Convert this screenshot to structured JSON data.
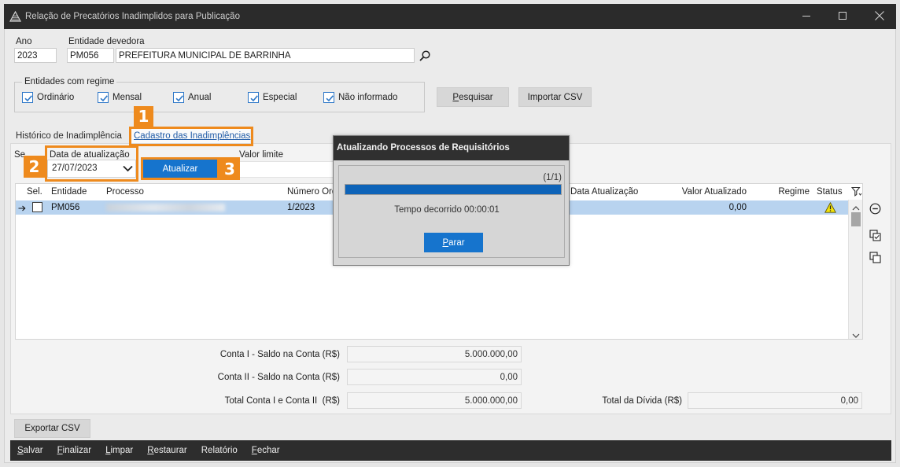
{
  "window": {
    "title": "Relação de Precatórios Inadimplidos para Publicação",
    "icons": {
      "app": "app-logo-icon",
      "minimize": "minimize-icon",
      "maximize": "maximize-icon",
      "close": "close-icon"
    }
  },
  "filters": {
    "ano_label": "Ano",
    "ano_value": "2023",
    "entidade_label": "Entidade devedora",
    "entidade_code": "PM056",
    "entidade_name": "PREFEITURA MUNICIPAL DE BARRINHA",
    "search_icon": "search-icon"
  },
  "regime": {
    "legend": "Entidades com regime",
    "options": [
      {
        "label": "Ordinário",
        "checked": true
      },
      {
        "label": "Mensal",
        "checked": true
      },
      {
        "label": "Anual",
        "checked": true
      },
      {
        "label": "Especial",
        "checked": true
      },
      {
        "label": "Não informado",
        "checked": true
      }
    ]
  },
  "actions": {
    "search_label": "Pesquisar",
    "import_label": "Importar CSV"
  },
  "tabs": [
    {
      "label": "Histórico de Inadimplência",
      "active": false
    },
    {
      "label": "Cadastro das Inadimplências",
      "active": true
    }
  ],
  "update_bar": {
    "sel_label": "Se",
    "date_label": "Data de atualização",
    "date_value": "27/07/2023",
    "update_label": "Atualizar",
    "limit_label": "Valor limite"
  },
  "table": {
    "columns": [
      "Sel.",
      "Entidade",
      "Processo",
      "Número Ord",
      "Data Atualização",
      "Valor Atualizado",
      "Regime",
      "Status"
    ],
    "filter_icon": "filter-icon",
    "rows": [
      {
        "selected": false,
        "entidade": "PM056",
        "numero": "1/2023",
        "valor": "0,00",
        "status_icon": "warning-icon"
      }
    ]
  },
  "side_tools": [
    "minus-circle-icon",
    "check-copy-icon",
    "copy-icon"
  ],
  "summary": {
    "conta1_label": "Conta I - Saldo na Conta (R$)",
    "conta1_value": "5.000.000,00",
    "conta2_label": "Conta II - Saldo na Conta (R$)",
    "conta2_value": "0,00",
    "total_label": "Total Conta I e Conta II  (R$)",
    "total_value": "5.000.000,00",
    "divida_label": "Total da Dívida (R$)",
    "divida_value": "0,00"
  },
  "export_label": "Exportar CSV",
  "menu": [
    "Salvar",
    "Finalizar",
    "Limpar",
    "Restaurar",
    "Relatório",
    "Fechar"
  ],
  "dialog": {
    "title": "Atualizando Processos de Requisitórios",
    "counter": "(1/1)",
    "progress": 1,
    "elapsed": "Tempo decorrido 00:00:01",
    "stop_label": "Parar"
  },
  "annotations": [
    "1",
    "2",
    "3"
  ],
  "colors": {
    "title_bar": "#2b2b2b",
    "accent_blue": "#1674cd",
    "annotation_orange": "#ee8a1d",
    "selected_row": "#b8d3ef",
    "warning_yellow": "#f2e30c",
    "bottom_bar": "#2d2d2d"
  }
}
